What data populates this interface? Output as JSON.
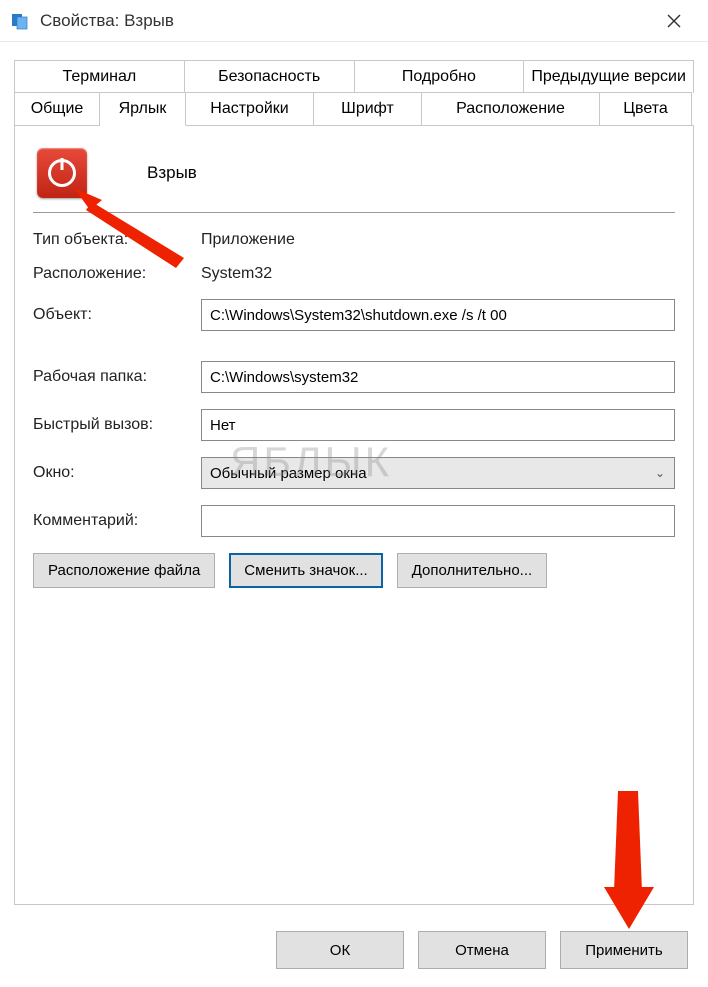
{
  "titlebar": {
    "title": "Свойства: Взрыв"
  },
  "tabs_row1": [
    "Терминал",
    "Безопасность",
    "Подробно",
    "Предыдущие версии"
  ],
  "tabs_row2": [
    "Общие",
    "Ярлык",
    "Настройки",
    "Шрифт",
    "Расположение",
    "Цвета"
  ],
  "active_tab": "Ярлык",
  "app_name": "Взрыв",
  "props": {
    "type_label": "Тип объекта:",
    "type_value": "Приложение",
    "location_label": "Расположение:",
    "location_value": "System32",
    "target_label": "Объект:",
    "target_value": "C:\\Windows\\System32\\shutdown.exe /s /t 00",
    "workdir_label": "Рабочая папка:",
    "workdir_value": "C:\\Windows\\system32",
    "shortcut_label": "Быстрый вызов:",
    "shortcut_value": "Нет",
    "window_label": "Окно:",
    "window_value": "Обычный размер окна",
    "comment_label": "Комментарий:",
    "comment_value": ""
  },
  "buttons": {
    "file_location": "Расположение файла",
    "change_icon": "Сменить значок...",
    "advanced": "Дополнительно...",
    "ok": "ОК",
    "cancel": "Отмена",
    "apply": "Применить"
  },
  "watermark": "ЯБЛЫК"
}
